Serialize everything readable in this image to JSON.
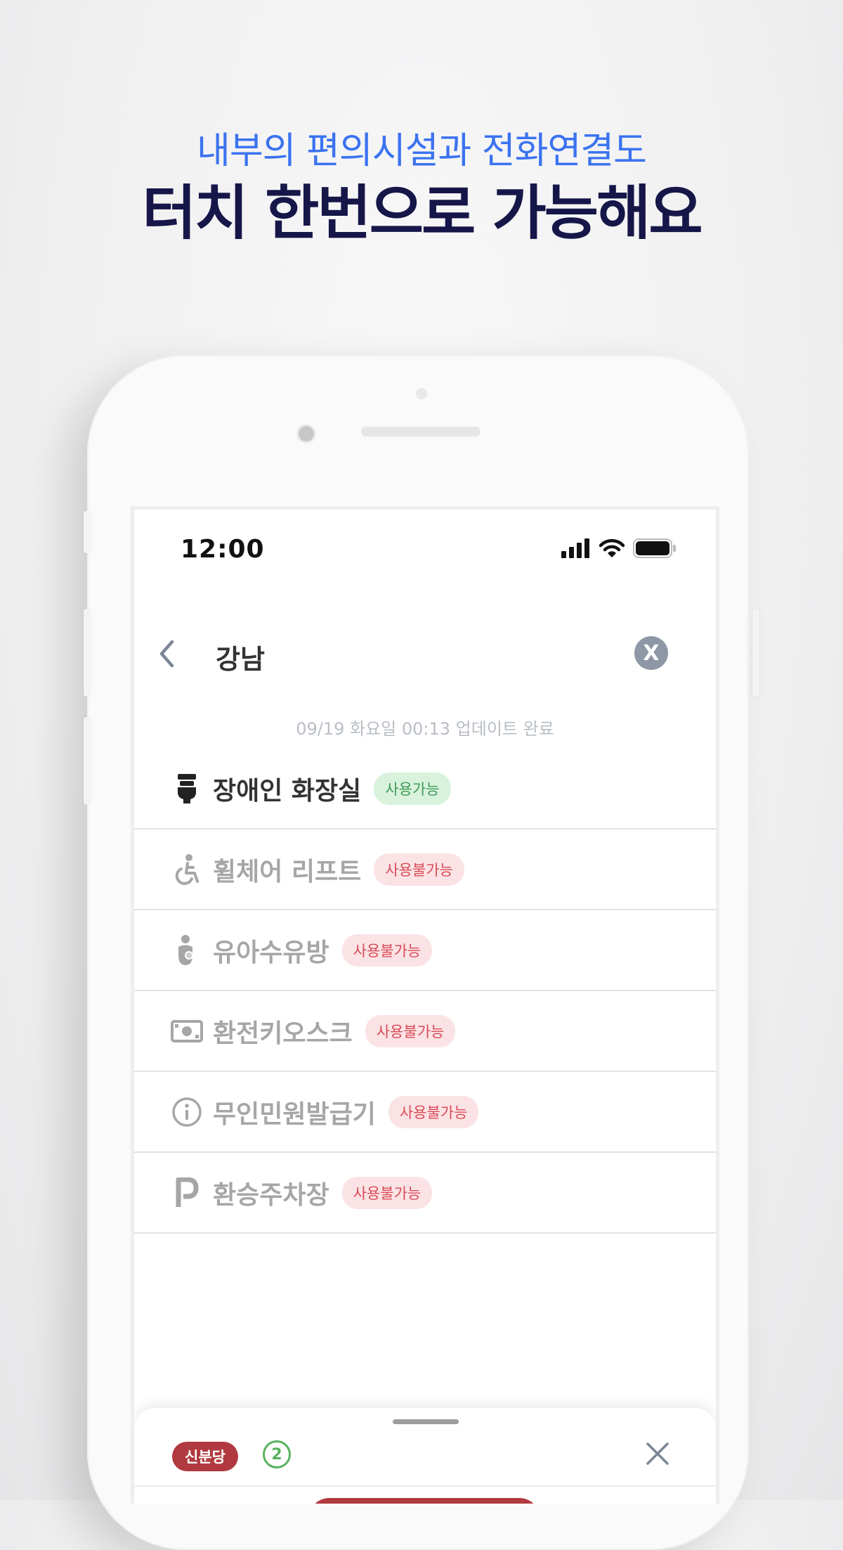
{
  "headline": {
    "subtitle": "내부의 편의시설과 전화연결도",
    "title": "터치 한번으로 가능해요"
  },
  "status_bar": {
    "time": "12:00"
  },
  "search": {
    "query": "강남",
    "clear_label": "X"
  },
  "update_text": "09/19 화요일 00:13 업데이트 완료",
  "facilities": [
    {
      "label": "장애인 화장실",
      "status": "사용가능",
      "icon": "toilet-icon"
    },
    {
      "label": "휠체어 리프트",
      "status": "사용불가능",
      "icon": "wheelchair-icon"
    },
    {
      "label": "유아수유방",
      "status": "사용불가능",
      "icon": "nursing-room-icon"
    },
    {
      "label": "환전키오스크",
      "status": "사용불가능",
      "icon": "money-icon"
    },
    {
      "label": "무인민원발급기",
      "status": "사용불가능",
      "icon": "info-icon"
    },
    {
      "label": "환승주차장",
      "status": "사용불가능",
      "icon": "parking-icon"
    }
  ],
  "bottom_sheet": {
    "line_name": "신분당",
    "count": "2"
  },
  "colors": {
    "accent_blue": "#3b73f0",
    "title_navy": "#161649",
    "available_green": "#3f9a56",
    "unavailable_red": "#d94c57",
    "line_sinbundang": "#b03a3f"
  }
}
